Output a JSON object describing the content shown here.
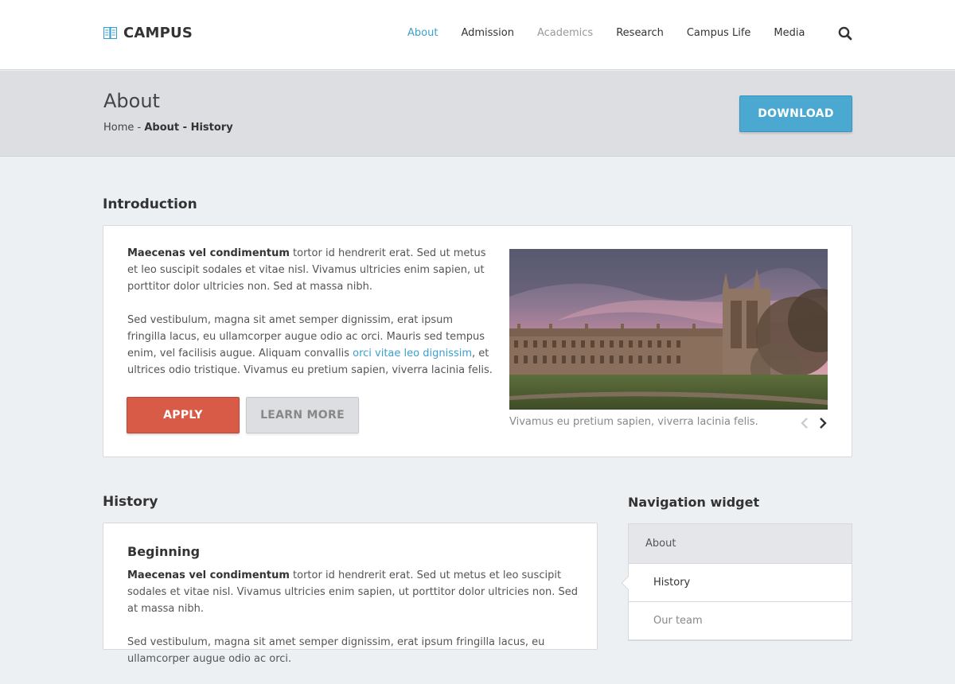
{
  "brand": {
    "name": "CAMPUS",
    "icon": "book-icon"
  },
  "nav": {
    "items": [
      {
        "label": "About",
        "state": "active"
      },
      {
        "label": "Admission",
        "state": "normal"
      },
      {
        "label": "Academics",
        "state": "muted"
      },
      {
        "label": "Research",
        "state": "normal"
      },
      {
        "label": "Campus Life",
        "state": "normal"
      },
      {
        "label": "Media",
        "state": "normal"
      }
    ],
    "search_icon": "search-icon"
  },
  "page": {
    "title": "About",
    "breadcrumb": {
      "home": "Home",
      "sep": " - ",
      "current": "About - History"
    },
    "download_label": "DOWNLOAD"
  },
  "intro": {
    "heading": "Introduction",
    "p1_bold": "Maecenas vel condimentum",
    "p1_rest": " tortor id hendrerit erat. Sed ut metus et leo suscipit sodales et vitae nisl. Vivamus ultricies enim sapien, ut porttitor dolor ultricies non. Sed at massa nibh.",
    "p2_before": "Sed vestibulum, magna sit amet semper dignissim, erat ipsum fringilla lacus, eu ullamcorper augue odio ac orci. Mauris sed tempus enim, vel facilisis augue. Aliquam convallis ",
    "p2_link": "orci vitae leo dignissim",
    "p2_after": ", et ultrices odio tristique. Vivamus eu pretium sapien, viverra lacinia felis.",
    "apply_label": "APPLY",
    "learn_label": "LEARN MORE",
    "caption": "Vivamus eu pretium sapien, viverra lacinia felis."
  },
  "history": {
    "heading": "History",
    "subheading": "Beginning",
    "p1_bold": "Maecenas vel condimentum",
    "p1_rest": " tortor id hendrerit erat. Sed ut metus et leo suscipit sodales et vitae nisl. Vivamus ultricies enim sapien, ut porttitor dolor ultricies non. Sed at massa nibh.",
    "p2": "Sed vestibulum, magna sit amet semper dignissim, erat ipsum fringilla lacus, eu ullamcorper augue odio ac orci."
  },
  "widget": {
    "heading": "Navigation widget",
    "items": [
      {
        "label": "About",
        "state": "header"
      },
      {
        "label": "History",
        "state": "selected"
      },
      {
        "label": "Our team",
        "state": "sub"
      }
    ]
  },
  "colors": {
    "accent": "#3d9fcb",
    "download": "#4aa8d1",
    "apply": "#d85b48",
    "background": "#edf0f3",
    "titlebar": "#dcdee1"
  }
}
